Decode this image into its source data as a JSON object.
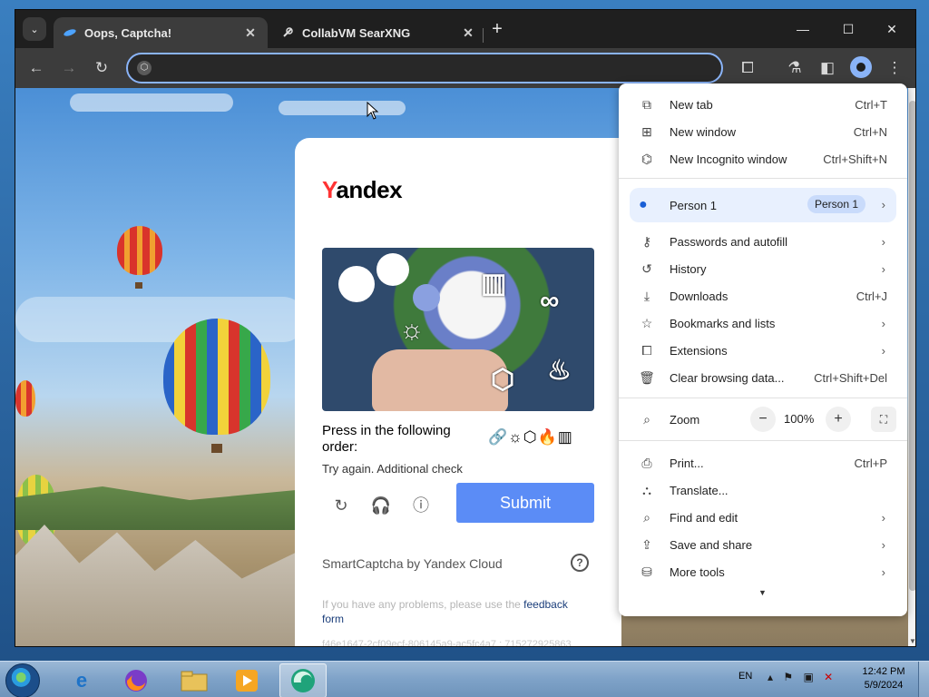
{
  "tabs": [
    {
      "title": "Oops, Captcha!",
      "active": true
    },
    {
      "title": "CollabVM SearXNG",
      "active": false
    }
  ],
  "omnibox": {
    "value": "",
    "placeholder": ""
  },
  "captcha": {
    "brand_first": "Y",
    "brand_rest": "andex",
    "instruction": "Press in the following order:",
    "order_icons": "🔗☼⬡🔥▥",
    "status": "Try again. Additional check",
    "submit_label": "Submit",
    "provider": "SmartCaptcha by Yandex Cloud",
    "feedback_text": "If you have any problems, please use the ",
    "feedback_link": "feedback form",
    "hash": "f46e1647-2cf09ecf-806145a9-ac5fc4a7 : 715272925863"
  },
  "menu": {
    "items_group1": [
      {
        "icon": "new-tab-icon",
        "glyph": "⧉",
        "label": "New tab",
        "shortcut": "Ctrl+T"
      },
      {
        "icon": "new-window-icon",
        "glyph": "⊞",
        "label": "New window",
        "shortcut": "Ctrl+N"
      },
      {
        "icon": "incognito-icon",
        "glyph": "⌬",
        "label": "New Incognito window",
        "shortcut": "Ctrl+Shift+N"
      }
    ],
    "person": {
      "label": "Person 1",
      "chip": "Person 1"
    },
    "items_group2": [
      {
        "icon": "key-icon",
        "glyph": "⚷",
        "label": "Passwords and autofill",
        "arrow": true
      },
      {
        "icon": "history-icon",
        "glyph": "↺",
        "label": "History",
        "arrow": true
      },
      {
        "icon": "download-icon",
        "glyph": "⤓",
        "label": "Downloads",
        "shortcut": "Ctrl+J"
      },
      {
        "icon": "star-icon",
        "glyph": "☆",
        "label": "Bookmarks and lists",
        "arrow": true
      },
      {
        "icon": "extension-icon",
        "glyph": "⧠",
        "label": "Extensions",
        "arrow": true
      },
      {
        "icon": "trash-icon",
        "glyph": "🗑",
        "label": "Clear browsing data...",
        "shortcut": "Ctrl+Shift+Del"
      }
    ],
    "zoom": {
      "label": "Zoom",
      "minus": "−",
      "value": "100%",
      "plus": "+"
    },
    "items_group3": [
      {
        "icon": "print-icon",
        "glyph": "⎙",
        "label": "Print...",
        "shortcut": "Ctrl+P"
      },
      {
        "icon": "translate-icon",
        "glyph": "⛬",
        "label": "Translate...",
        "arrow": false
      },
      {
        "icon": "find-icon",
        "glyph": "⌕",
        "label": "Find and edit",
        "arrow": true
      },
      {
        "icon": "save-share-icon",
        "glyph": "⇪",
        "label": "Save and share",
        "arrow": true
      },
      {
        "icon": "toolbox-icon",
        "glyph": "⛁",
        "label": "More tools",
        "arrow": true
      }
    ]
  },
  "taskbar": {
    "language": "EN",
    "time": "12:42 PM",
    "date": "5/9/2024"
  },
  "colors": {
    "accent": "#8ab4f8",
    "submit": "#5b8cf6",
    "brand_red": "#ff3333"
  }
}
